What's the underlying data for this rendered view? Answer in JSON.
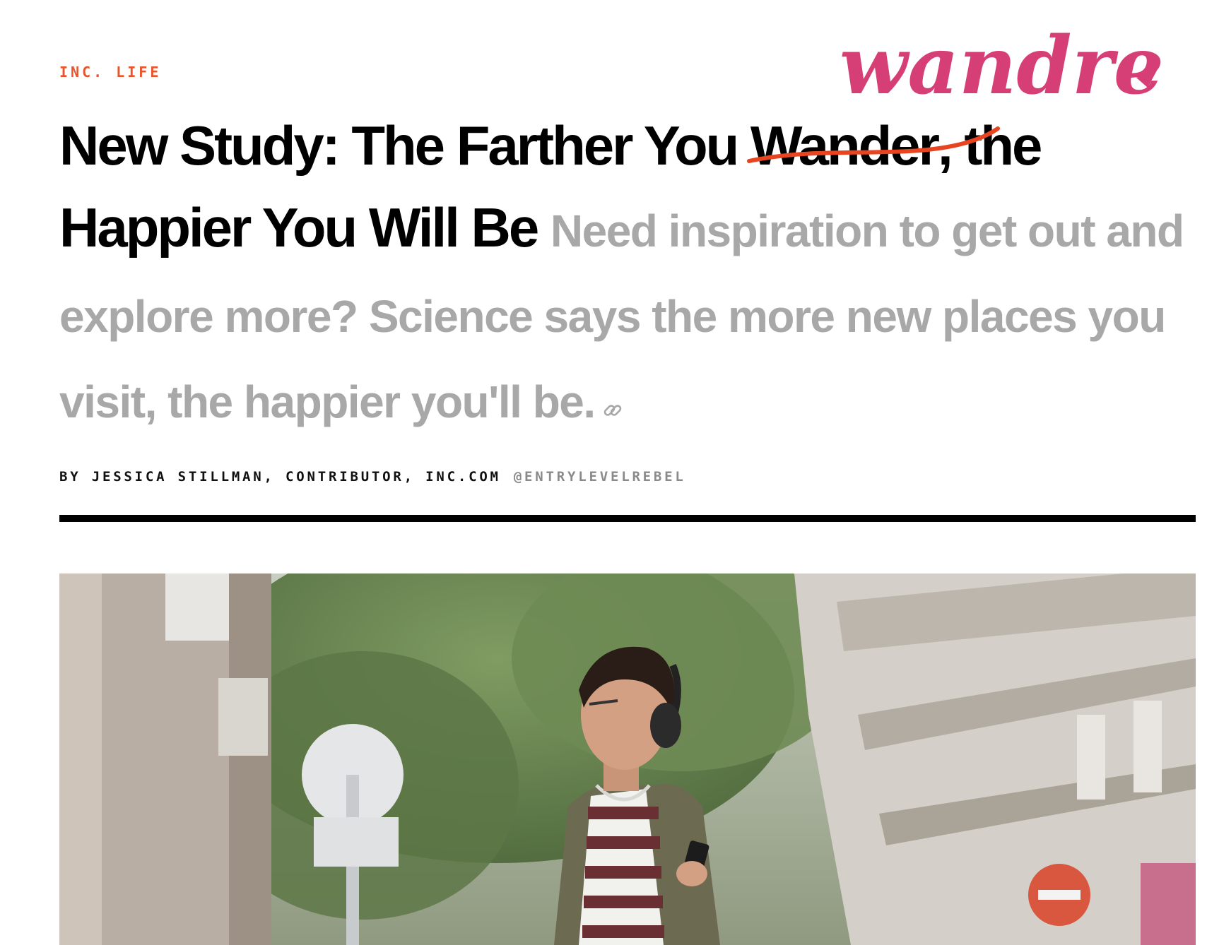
{
  "article": {
    "section_label": "INC. LIFE",
    "headline_part1": "New Study: The Farther You ",
    "headline_struck_word": "Wander",
    "headline_part2": ", the Happier You Will Be",
    "dek": "Need inspiration to get out and explore more? Science says the more new places you visit, the happier you'll be.",
    "byline": "BY JESSICA STILLMAN, CONTRIBUTOR, INC.COM",
    "twitter_handle": "@ENTRYLEVELREBEL"
  },
  "annotation": {
    "replacement_word": "wandrer",
    "color": "#d63f76",
    "strike_color": "#e8441f"
  },
  "icons": {
    "permalink": "link-icon"
  },
  "colors": {
    "section_label": "#e8552d",
    "headline": "#000000",
    "dek": "#a8a8a8",
    "byline": "#111111",
    "handle": "#8a8a8a"
  }
}
